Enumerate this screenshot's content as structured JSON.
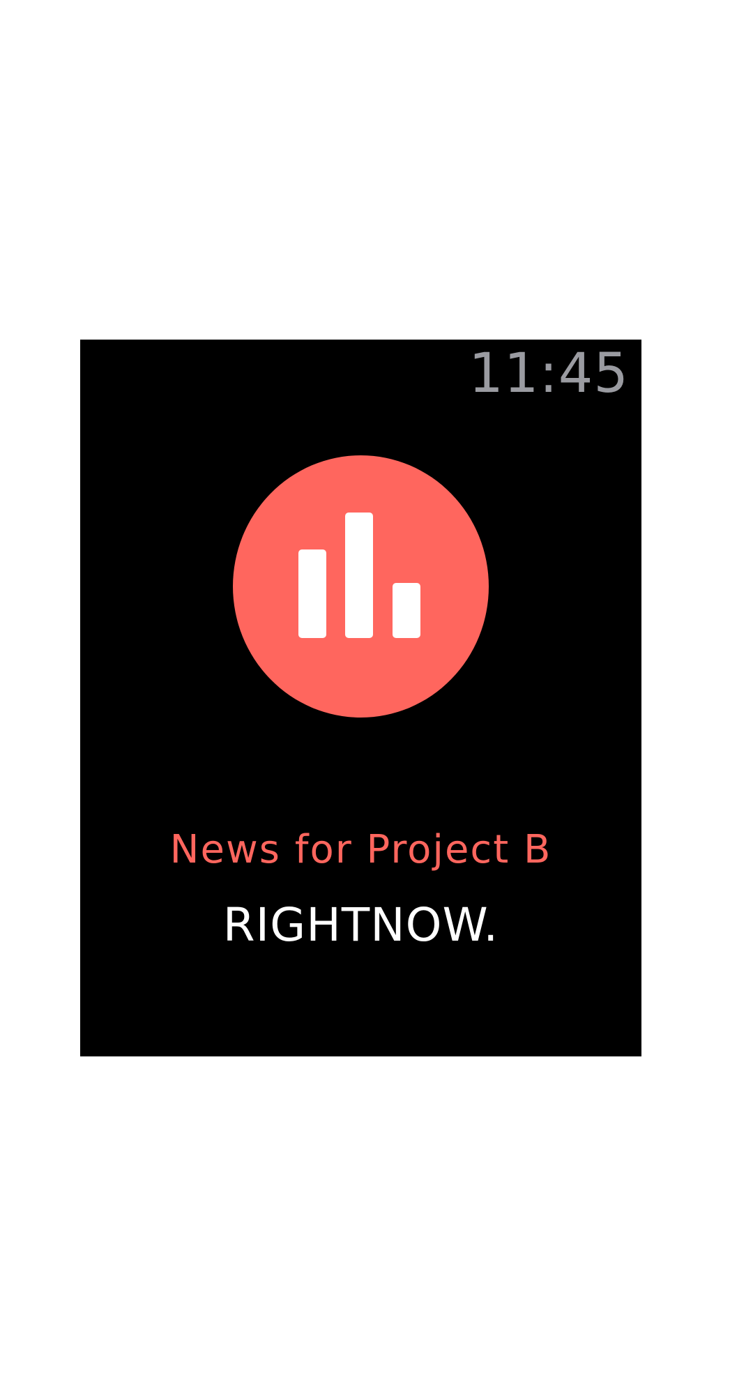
{
  "status_bar": {
    "time": "11:45"
  },
  "notification": {
    "app_icon": "bar-chart-icon",
    "title": "News for Project B",
    "body": "RIGHTNOW."
  },
  "colors": {
    "accent": "#ff665e",
    "background": "#000000",
    "time": "#9a9ba1",
    "body_text": "#ffffff"
  }
}
